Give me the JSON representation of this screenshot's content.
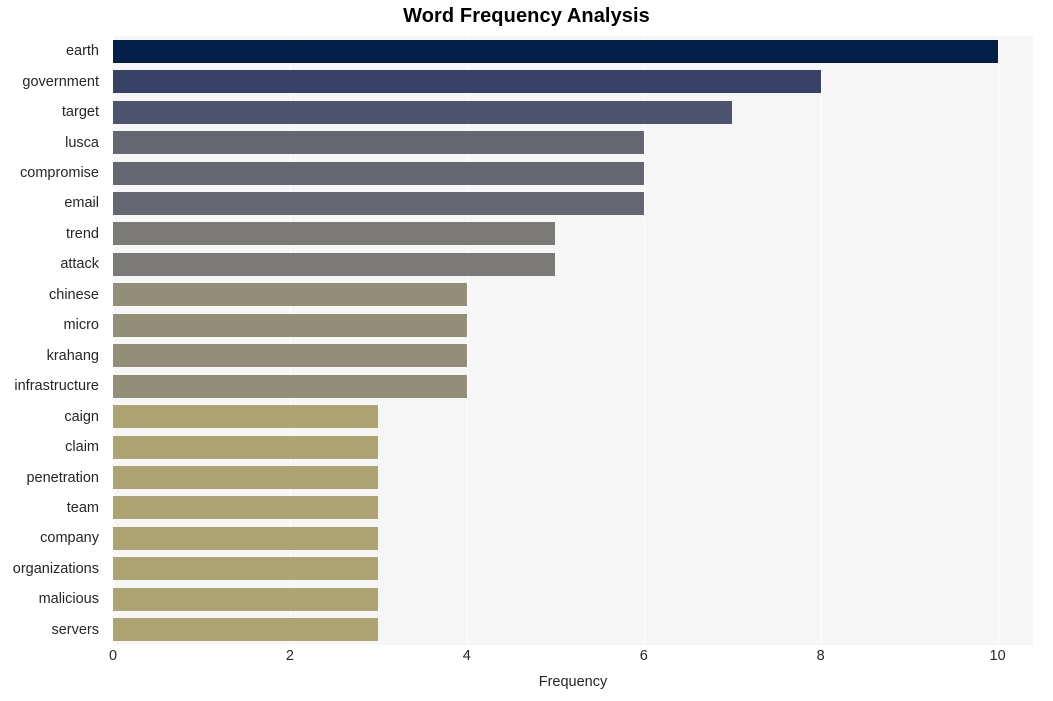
{
  "chart_data": {
    "type": "bar",
    "orientation": "horizontal",
    "title": "Word Frequency Analysis",
    "xlabel": "Frequency",
    "ylabel": "",
    "xlim": [
      0,
      10.4
    ],
    "xticks": [
      0,
      2,
      4,
      6,
      8,
      10
    ],
    "xtick_labels": [
      "0",
      "2",
      "4",
      "6",
      "8",
      "10"
    ],
    "grid": true,
    "grid_axis": "x",
    "legend": null,
    "categories": [
      "earth",
      "government",
      "target",
      "lusca",
      "compromise",
      "email",
      "trend",
      "attack",
      "chinese",
      "micro",
      "krahang",
      "infrastructure",
      "caign",
      "claim",
      "penetration",
      "team",
      "company",
      "organizations",
      "malicious",
      "servers"
    ],
    "values": [
      10,
      8,
      7,
      6,
      6,
      6,
      5,
      5,
      4,
      4,
      4,
      4,
      3,
      3,
      3,
      3,
      3,
      3,
      3,
      3
    ],
    "bar_colors": [
      "#04204a",
      "#384266",
      "#4d5470",
      "#646672",
      "#646672",
      "#646672",
      "#7b7a76",
      "#7b7a76",
      "#938e77",
      "#938e77",
      "#938e77",
      "#938e77",
      "#aea473",
      "#aea473",
      "#aea473",
      "#aea473",
      "#aea473",
      "#aea473",
      "#aea473",
      "#aea473"
    ],
    "plot_background": "#f6f6f6",
    "figure_background": "#ffffff",
    "text_color": "#262626",
    "title_color": "#000000"
  }
}
